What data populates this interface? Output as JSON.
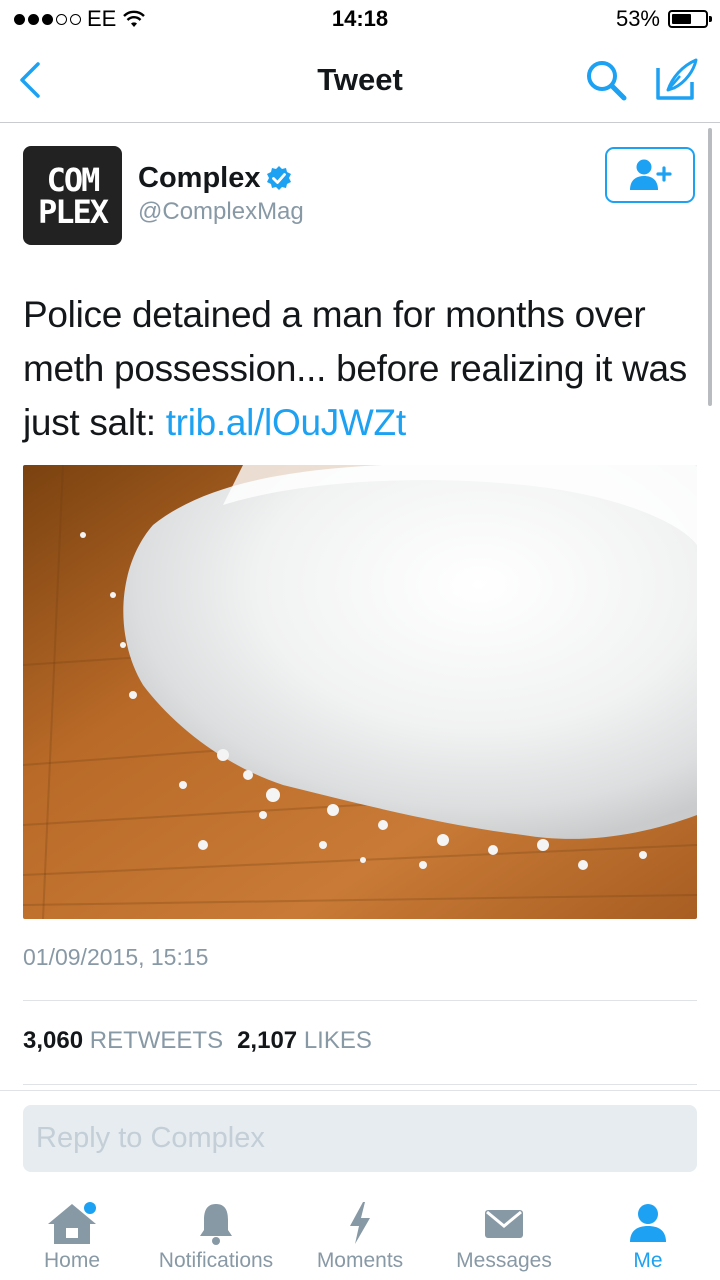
{
  "status_bar": {
    "carrier": "EE",
    "time": "14:18",
    "battery": "53%",
    "battery_level": 0.53,
    "signal_dots_filled": 3,
    "signal_dots_total": 5
  },
  "nav": {
    "title": "Tweet",
    "back_icon": "chevron-left-icon",
    "search_icon": "search-icon",
    "compose_icon": "compose-icon"
  },
  "tweet": {
    "avatar_line1": "COM",
    "avatar_line2": "PLEX",
    "display_name": "Complex",
    "handle": "@ComplexMag",
    "text": "Police detained a man for months over meth possession... before realizing it was just salt: ",
    "link": "trib.al/lOuJWZt",
    "timestamp": "01/09/2015, 15:15",
    "retweets_count": "3,060",
    "retweets_label": "RETWEETS",
    "likes_count": "2,107",
    "likes_label": "LIKES"
  },
  "reply": {
    "placeholder": "Reply to Complex"
  },
  "tabs": [
    {
      "label": "Home",
      "icon": "home-icon",
      "active": false,
      "badge": true
    },
    {
      "label": "Notifications",
      "icon": "bell-icon",
      "active": false
    },
    {
      "label": "Moments",
      "icon": "lightning-icon",
      "active": false
    },
    {
      "label": "Messages",
      "icon": "envelope-icon",
      "active": false
    },
    {
      "label": "Me",
      "icon": "person-icon",
      "active": true
    }
  ],
  "colors": {
    "accent": "#1da1f2",
    "secondary_text": "#8899a6"
  }
}
